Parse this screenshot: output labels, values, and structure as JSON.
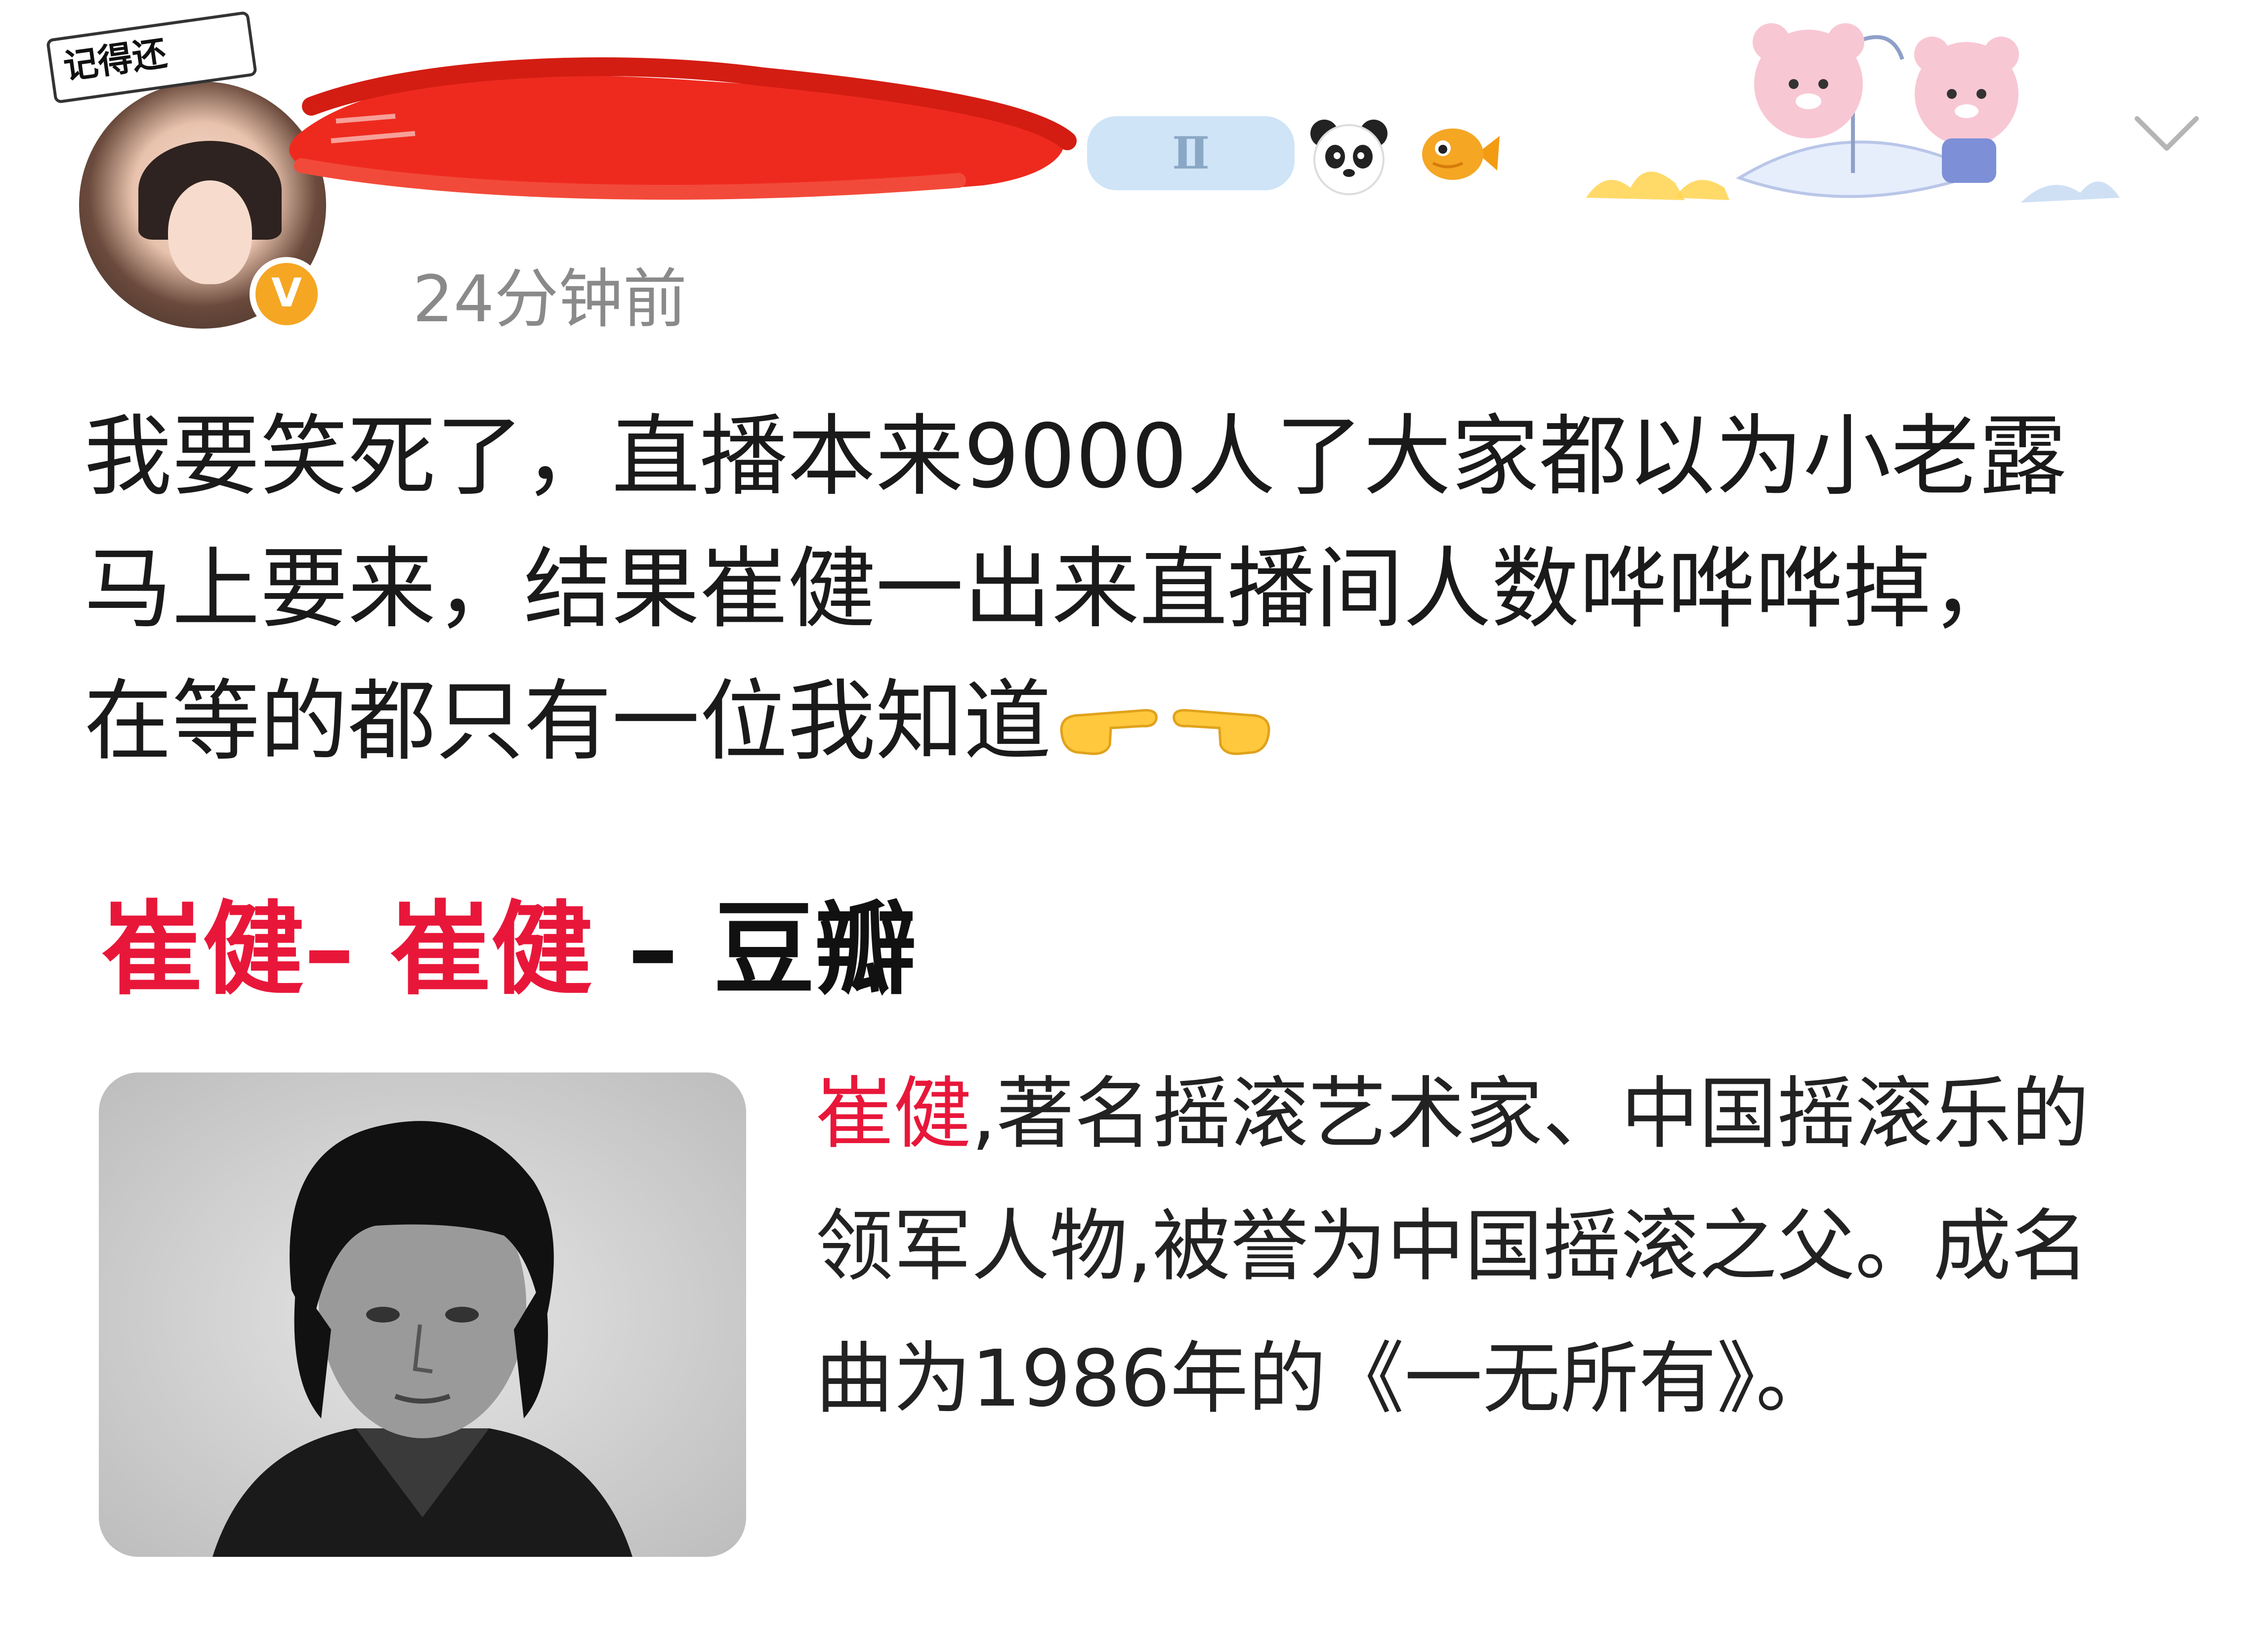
{
  "post": {
    "avatar_label": "记得还",
    "verified_badge": "V",
    "tier_badge": "Ⅱ",
    "timestamp": "24分钟前",
    "text_line1": "我要笑死了，直播本来9000人了大家都以为小老露",
    "text_line2": "马上要来，结果崔健一出来直播间人数哗哗哗掉，",
    "text_line3": "在等的都只有一位我知道",
    "emojis": [
      "pointing-right-emoji",
      "pointing-left-emoji"
    ]
  },
  "card": {
    "title_part1": "崔健",
    "title_part2": "– ",
    "title_part3": "崔健",
    "title_part4": " – 豆瓣",
    "snippet_highlight": "崔健",
    "snippet_line1": ",著名摇滚艺术家、中国摇滚乐的",
    "snippet_line2": "领军人物,被誉为中国摇滚之父。成名",
    "snippet_line3": "曲为1986年的《一无所有》。"
  },
  "colors": {
    "highlight": "#e8173a",
    "timestamp": "#8a8a8a",
    "scribble": "#ee2a1e"
  }
}
